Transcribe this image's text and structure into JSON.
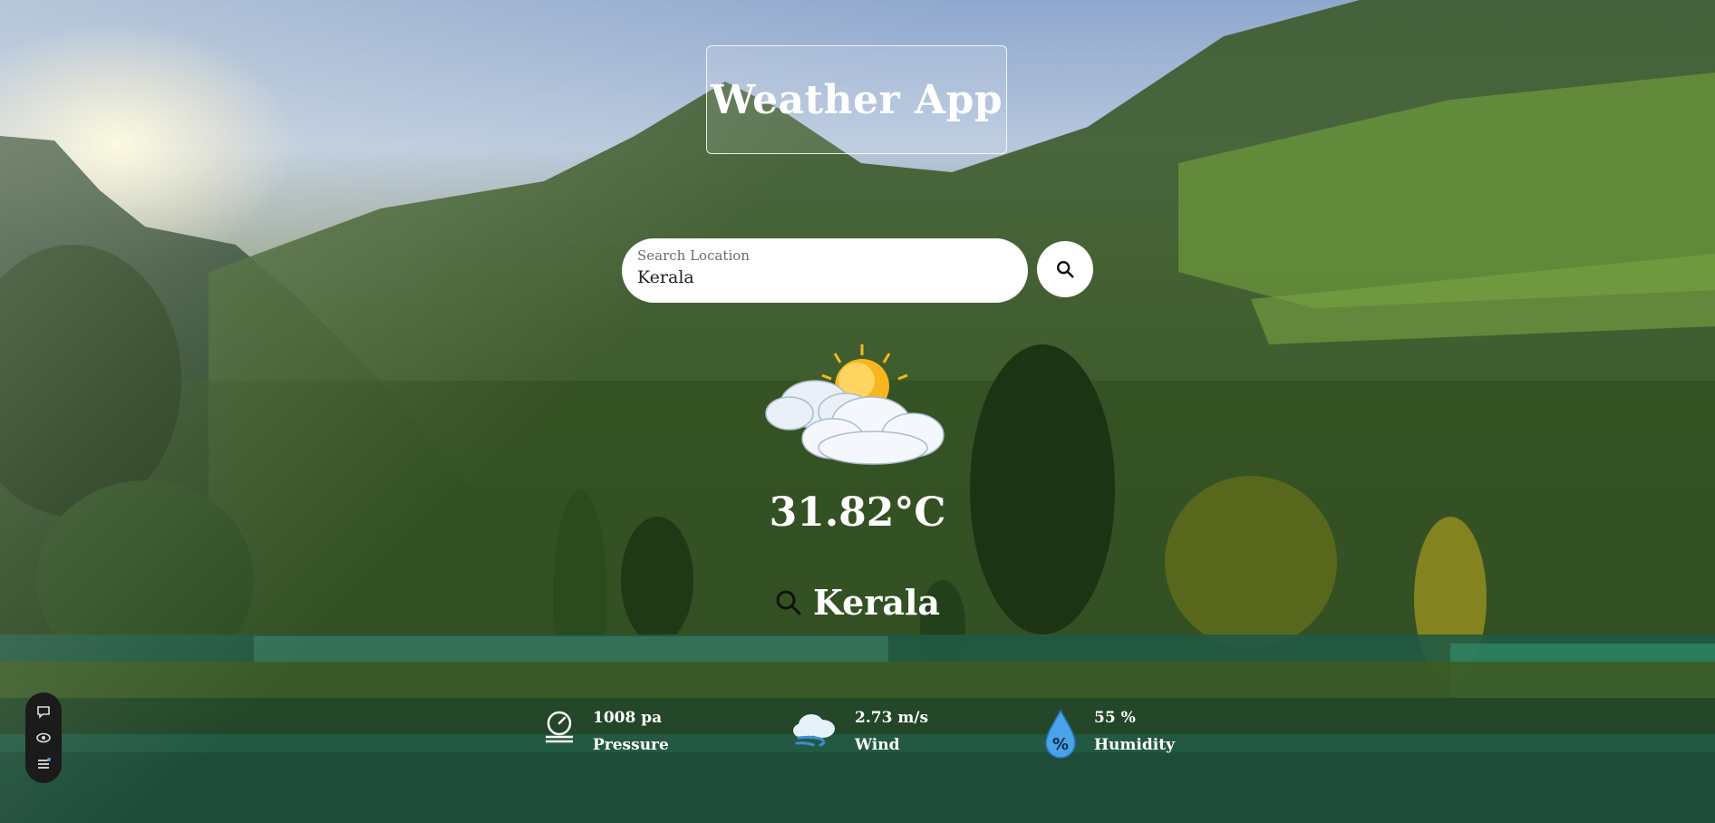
{
  "app": {
    "title": "Weather App"
  },
  "search": {
    "label": "Search Location",
    "value": "Kerala",
    "button_icon": "search-icon"
  },
  "weather": {
    "icon": "partly-cloudy-sun-icon",
    "temperature": "31.82°C",
    "city": "Kerala",
    "city_icon": "search-icon"
  },
  "stats": {
    "pressure": {
      "value": "1008 pa",
      "label": "Pressure",
      "icon": "gauge-icon"
    },
    "wind": {
      "value": "2.73 m/s",
      "label": "Wind",
      "icon": "windy-cloud-icon"
    },
    "humidity": {
      "value": "55 %",
      "label": "Humidity",
      "icon": "water-drop-percent-icon"
    }
  },
  "side_toolbar": {
    "items": [
      "chat-icon",
      "eye-icon",
      "menu-icon"
    ]
  },
  "colors": {
    "text": "#ffffff",
    "search_bg": "#ffffff",
    "toolbar_bg": "#1b1b1b"
  }
}
